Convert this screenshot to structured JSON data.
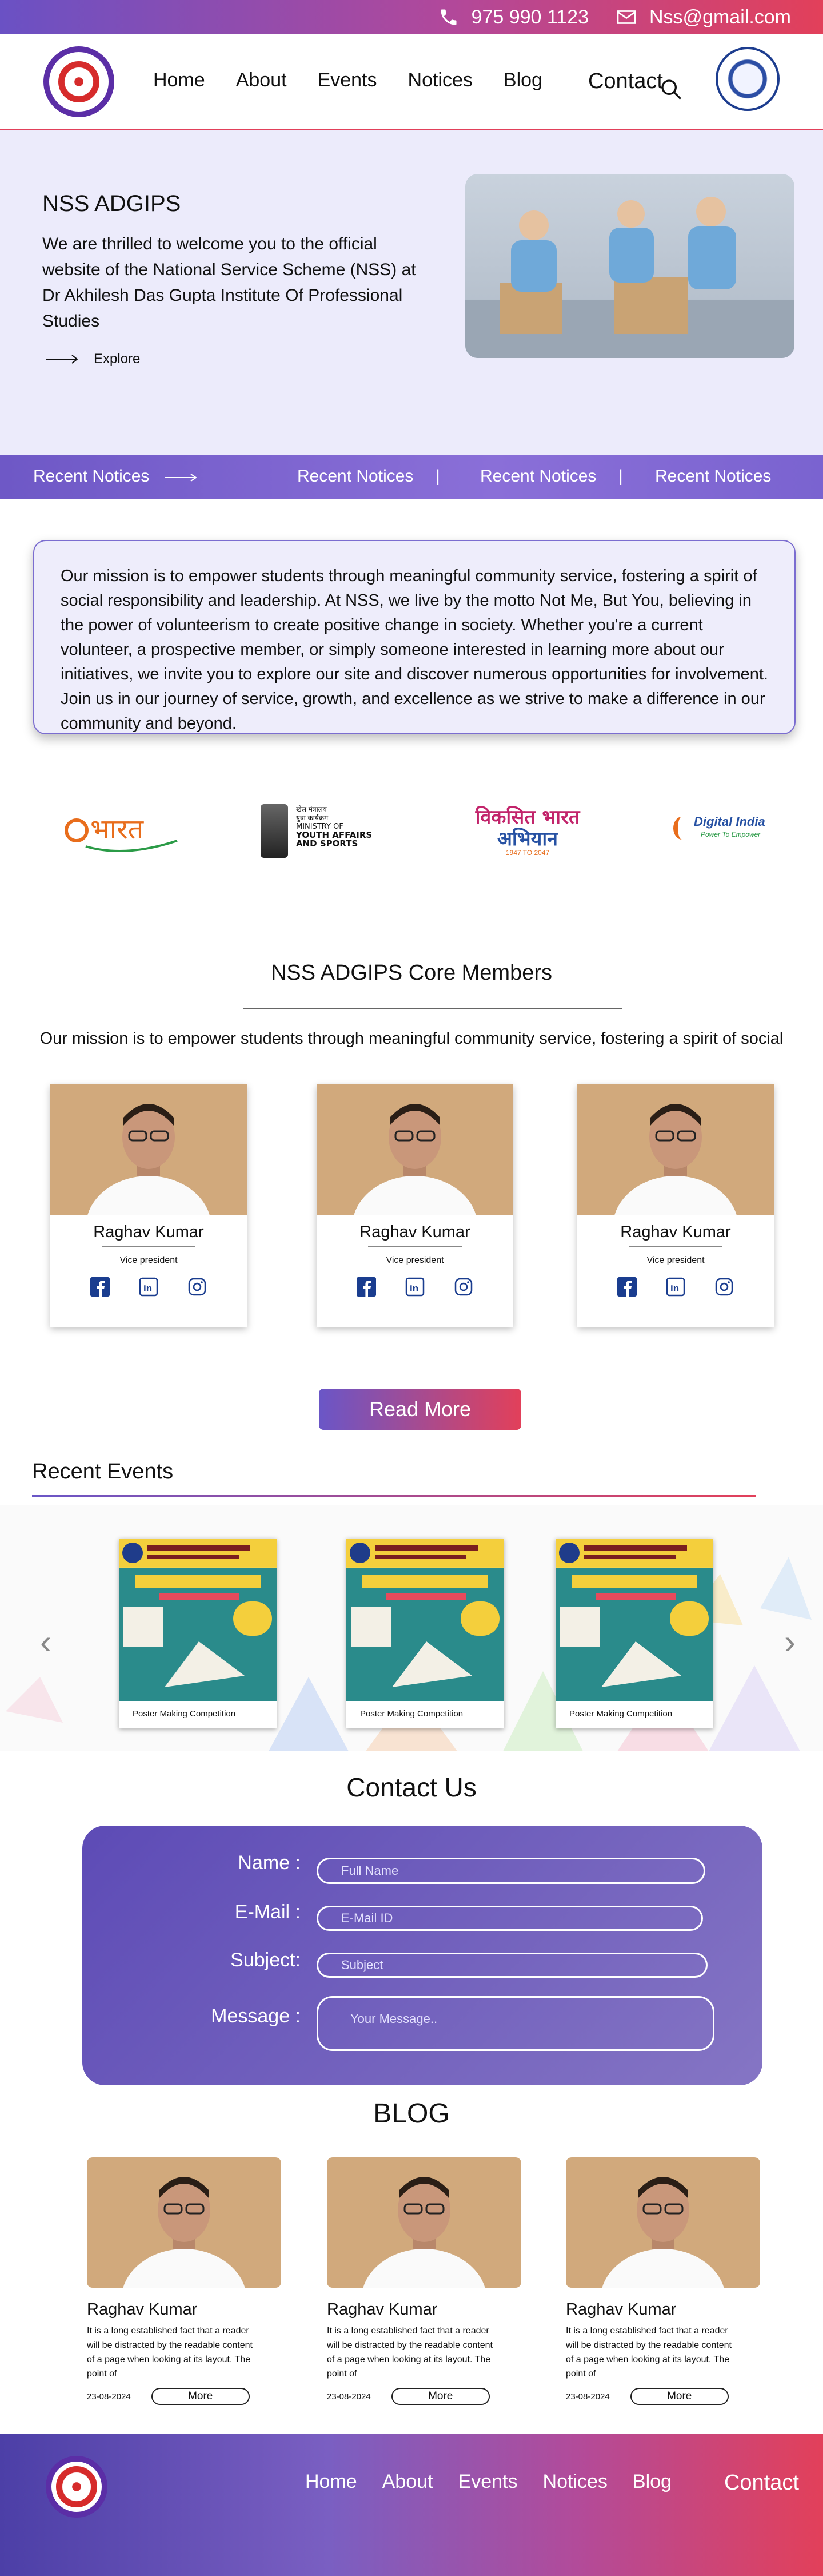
{
  "topbar": {
    "phone": "975 990 1123",
    "email": "Nss@gmail.com"
  },
  "nav": {
    "items": [
      "Home",
      "About",
      "Events",
      "Notices",
      "Blog",
      "Contact"
    ]
  },
  "hero": {
    "title": "NSS ADGIPS",
    "text": "We are thrilled to welcome you to the official website of the National Service Scheme (NSS) at Dr Akhilesh Das Gupta Institute Of Professional Studies",
    "explore": "Explore"
  },
  "ticker": {
    "items": [
      "Recent Notices",
      "Recent Notices",
      "Recent Notices",
      "Recent Notices"
    ],
    "separator": "|"
  },
  "mission": {
    "text": "Our mission is to empower students through meaningful community service, fostering a spirit of social responsibility and leadership. At NSS, we live by the motto Not Me, But You, believing in the power of volunteerism to create positive change in society. Whether you're a current volunteer, a prospective member, or simply someone interested in learning more about our initiatives, we invite you to explore our site and discover numerous opportunities for involvement. Join us in our journey of service, growth, and excellence as we strive to make a difference in our community and beyond."
  },
  "partners": {
    "ministry": [
      "खेल मंत्रालय",
      "युवा कार्यक्रम",
      "MINISTRY OF",
      "YOUTH AFFAIRS",
      "AND SPORTS"
    ],
    "viksit": [
      "विकसित भारत",
      "अभियान",
      "1947 TO 2047"
    ],
    "digital": [
      "Digital India",
      "Power To Empower"
    ]
  },
  "core": {
    "title": "NSS ADGIPS Core Members",
    "subtitle": "Our mission is to empower students through meaningful community service, fostering a spirit of social",
    "members": [
      {
        "name": "Raghav Kumar",
        "role": "Vice president"
      },
      {
        "name": "Raghav Kumar",
        "role": "Vice president"
      },
      {
        "name": "Raghav Kumar",
        "role": "Vice president"
      }
    ],
    "read_more": "Read More"
  },
  "events": {
    "title": "Recent Events",
    "items": [
      {
        "caption": "Poster Making Competition"
      },
      {
        "caption": "Poster Making Competition"
      },
      {
        "caption": "Poster Making Competition"
      }
    ]
  },
  "contact": {
    "title": "Contact Us",
    "name_label": "Name :",
    "name_placeholder": "Full Name",
    "email_label": "E-Mail :",
    "email_placeholder": "E-Mail ID",
    "subject_label": "Subject:",
    "subject_placeholder": "Subject",
    "message_label": "Message :",
    "message_placeholder": "Your Message.."
  },
  "blog": {
    "title": "BLOG",
    "posts": [
      {
        "name": "Raghav Kumar",
        "text": "It is a long established fact that a reader will be distracted by the readable content of a page when looking at its layout. The point of",
        "date": "23-08-2024",
        "more": "More"
      },
      {
        "name": "Raghav Kumar",
        "text": "It is a long established fact that a reader will be distracted by the readable content of a page when looking at its layout. The point of",
        "date": "23-08-2024",
        "more": "More"
      },
      {
        "name": "Raghav Kumar",
        "text": "It is a long established fact that a reader will be distracted by the readable content of a page when looking at its layout. The point of",
        "date": "23-08-2024",
        "more": "More"
      }
    ]
  },
  "footer": {
    "items": [
      "Home",
      "About",
      "Events",
      "Notices",
      "Blog",
      "Contact"
    ]
  },
  "colors": {
    "accent_purple": "#6a56c7",
    "accent_red": "#e2405a",
    "hero_bg": "#ecebfb"
  }
}
